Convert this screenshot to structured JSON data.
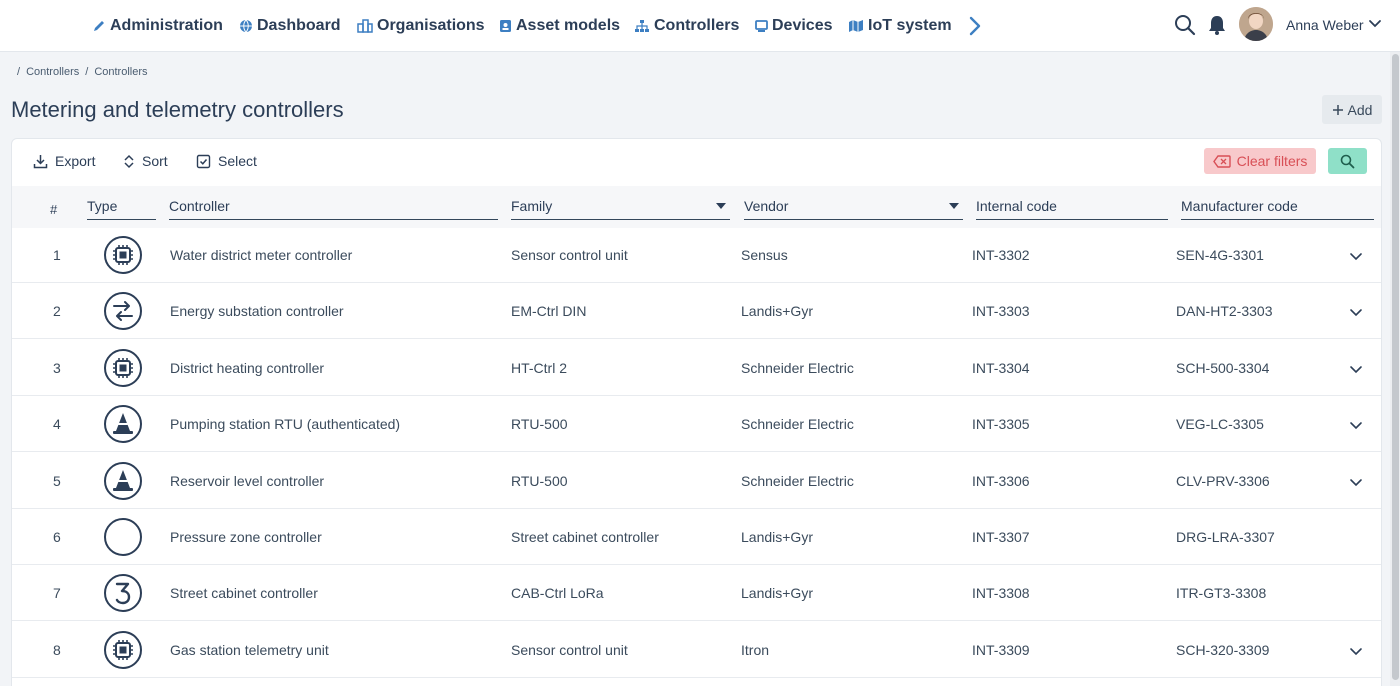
{
  "nav": {
    "items": [
      {
        "label": "Administration",
        "icon": "pencil-icon"
      },
      {
        "label": "Dashboard",
        "icon": "globe-icon"
      },
      {
        "label": "Organisations",
        "icon": "building-icon"
      },
      {
        "label": "Asset models",
        "icon": "id-card-icon"
      },
      {
        "label": "Controllers",
        "icon": "sitemap-icon"
      },
      {
        "label": "Devices",
        "icon": "monitor-icon"
      },
      {
        "label": "IoT system",
        "icon": "map-icon"
      }
    ],
    "user_name": "Anna Weber"
  },
  "breadcrumb": [
    "Controllers",
    "Controllers"
  ],
  "page_title": "Metering and telemetry controllers",
  "add_label": "Add",
  "toolbar": {
    "export": "Export",
    "sort": "Sort",
    "select": "Select",
    "clear_filters": "Clear filters"
  },
  "columns": {
    "num": "#",
    "type": "Type",
    "controller": "Controller",
    "family": "Family",
    "vendor": "Vendor",
    "internal_code": "Internal code",
    "manufacturer_code": "Manufacturer code"
  },
  "rows": [
    {
      "num": "1",
      "icon": "chip-icon",
      "controller": "Water district meter controller",
      "family": "Sensor control unit",
      "vendor": "Sensus",
      "internal_code": "INT-3302",
      "manufacturer_code": "SEN-4G-3301",
      "expandable": true
    },
    {
      "num": "2",
      "icon": "exchange-icon",
      "controller": "Energy substation controller",
      "family": "EM-Ctrl DIN",
      "vendor": "Landis+Gyr",
      "internal_code": "INT-3303",
      "manufacturer_code": "DAN-HT2-3303",
      "expandable": true
    },
    {
      "num": "3",
      "icon": "chip-icon",
      "controller": "District heating controller",
      "family": "HT-Ctrl 2",
      "vendor": "Schneider Electric",
      "internal_code": "INT-3304",
      "manufacturer_code": "SCH-500-3304",
      "expandable": true
    },
    {
      "num": "4",
      "icon": "cone-icon",
      "controller": "Pumping station RTU (authenticated)",
      "family": "RTU-500",
      "vendor": "Schneider Electric",
      "internal_code": "INT-3305",
      "manufacturer_code": "VEG-LC-3305",
      "expandable": true
    },
    {
      "num": "5",
      "icon": "cone-icon",
      "controller": "Reservoir level controller",
      "family": "RTU-500",
      "vendor": "Schneider Electric",
      "internal_code": "INT-3306",
      "manufacturer_code": "CLV-PRV-3306",
      "expandable": true
    },
    {
      "num": "6",
      "icon": "empty-circle-icon",
      "controller": "Pressure zone controller",
      "family": "Street cabinet controller",
      "vendor": "Landis+Gyr",
      "internal_code": "INT-3307",
      "manufacturer_code": "DRG-LRA-3307",
      "expandable": false
    },
    {
      "num": "7",
      "icon": "number-three-icon",
      "controller": "Street cabinet controller",
      "family": "CAB-Ctrl LoRa",
      "vendor": "Landis+Gyr",
      "internal_code": "INT-3308",
      "manufacturer_code": "ITR-GT3-3308",
      "expandable": false
    },
    {
      "num": "8",
      "icon": "chip-icon",
      "controller": "Gas station telemetry unit",
      "family": "Sensor control unit",
      "vendor": "Itron",
      "internal_code": "INT-3309",
      "manufacturer_code": "SCH-320-3309",
      "expandable": true
    }
  ],
  "colors": {
    "accent": "#2c3e57",
    "nav_icon": "#3d7fc2",
    "clear_bg": "#f8c9cb",
    "clear_text": "#d84f56",
    "search_bg": "#8fe0c8"
  }
}
